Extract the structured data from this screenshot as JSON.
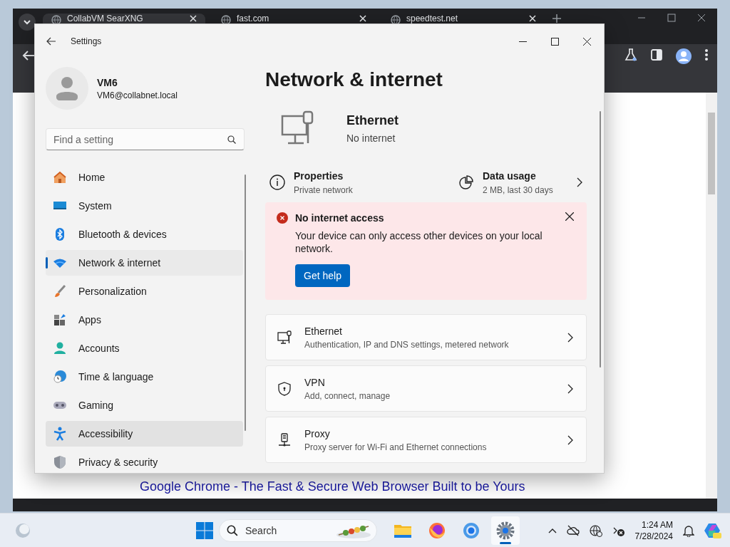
{
  "browser": {
    "tabs": [
      {
        "title": "CollabVM SearXNG",
        "selected": true
      },
      {
        "title": "fast.com",
        "selected": false
      },
      {
        "title": "speedtest.net",
        "selected": false
      }
    ],
    "result": {
      "title": "Google Chrome - The Fast & Secure Web Browser Built to be Yours"
    }
  },
  "settings": {
    "title": "Settings",
    "user": {
      "name": "VM6",
      "email": "VM6@collabnet.local"
    },
    "search": {
      "placeholder": "Find a setting"
    },
    "nav": [
      {
        "label": "Home",
        "selected": false,
        "highlighted": false
      },
      {
        "label": "System",
        "selected": false,
        "highlighted": false
      },
      {
        "label": "Bluetooth & devices",
        "selected": false,
        "highlighted": false
      },
      {
        "label": "Network & internet",
        "selected": true,
        "highlighted": false
      },
      {
        "label": "Personalization",
        "selected": false,
        "highlighted": false
      },
      {
        "label": "Apps",
        "selected": false,
        "highlighted": false
      },
      {
        "label": "Accounts",
        "selected": false,
        "highlighted": false
      },
      {
        "label": "Time & language",
        "selected": false,
        "highlighted": false
      },
      {
        "label": "Gaming",
        "selected": false,
        "highlighted": false
      },
      {
        "label": "Accessibility",
        "selected": false,
        "highlighted": true
      },
      {
        "label": "Privacy & security",
        "selected": false,
        "highlighted": false
      }
    ],
    "heading": "Network & internet",
    "connection": {
      "name": "Ethernet",
      "status": "No internet"
    },
    "properties": {
      "title": "Properties",
      "subtitle": "Private network"
    },
    "data_usage": {
      "title": "Data usage",
      "subtitle": "2 MB, last 30 days"
    },
    "alert": {
      "title": "No internet access",
      "message": "Your device can only access other devices on your local network.",
      "button": "Get help"
    },
    "cards": [
      {
        "kind": "ethernet",
        "title": "Ethernet",
        "subtitle": "Authentication, IP and DNS settings, metered network"
      },
      {
        "kind": "vpn",
        "title": "VPN",
        "subtitle": "Add, connect, manage"
      },
      {
        "kind": "proxy",
        "title": "Proxy",
        "subtitle": "Proxy server for Wi-Fi and Ethernet connections"
      }
    ]
  },
  "taskbar": {
    "search": {
      "placeholder": "Search"
    },
    "apps": [
      {
        "kind": "files",
        "active": false
      },
      {
        "kind": "firefox",
        "active": false
      },
      {
        "kind": "chrome",
        "active": false
      },
      {
        "kind": "settings",
        "active": true
      }
    ],
    "time": "1:24 AM",
    "date": "7/28/2024"
  }
}
